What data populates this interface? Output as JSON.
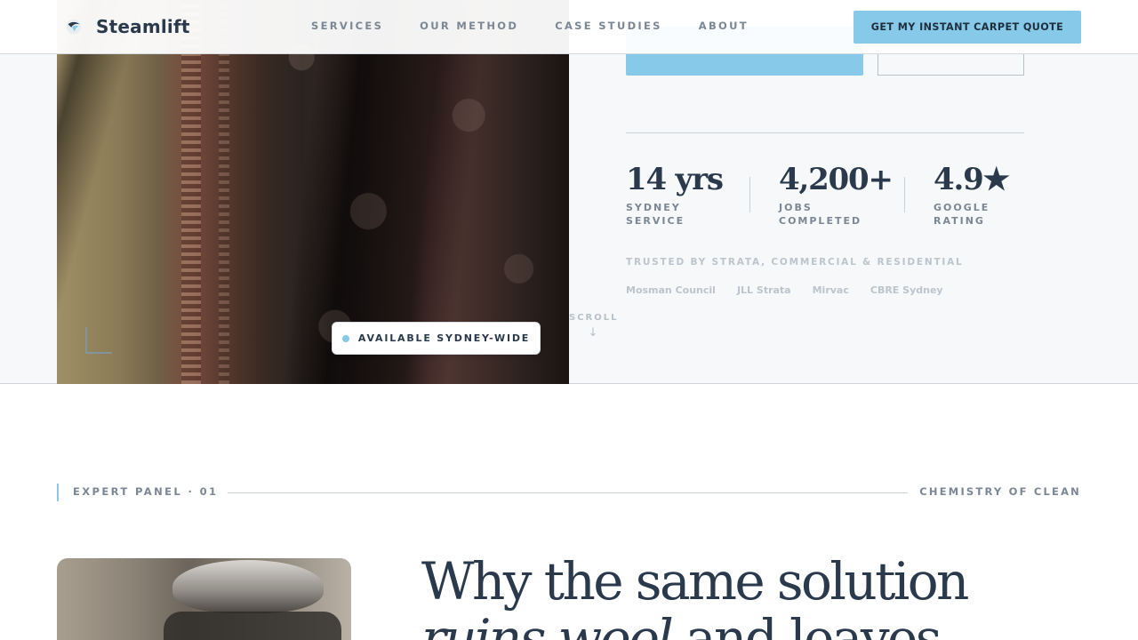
{
  "header": {
    "brand_name": "Steamlift",
    "nav": [
      "SERVICES",
      "OUR METHOD",
      "CASE STUDIES",
      "ABOUT"
    ],
    "cta_label": "GET MY INSTANT CARPET QUOTE"
  },
  "hero": {
    "badge_text": "AVAILABLE SYDNEY-WIDE",
    "scroll_label": "SCROLL",
    "stats": [
      {
        "value": "14 yrs",
        "label_line1": "SYDNEY",
        "label_line2": "SERVICE"
      },
      {
        "value": "4,200+",
        "label_line1": "JOBS",
        "label_line2": "COMPLETED"
      },
      {
        "value": "4.9★",
        "label_line1": "GOOGLE",
        "label_line2": "RATING"
      }
    ],
    "trusted_label": "TRUSTED BY STRATA, COMMERCIAL & RESIDENTIAL",
    "trusted_logos": [
      "Mosman Council",
      "JLL Strata",
      "Mirvac",
      "CBRE Sydney"
    ]
  },
  "section": {
    "panel_label": "EXPERT PANEL · 01",
    "panel_right": "CHEMISTRY OF CLEAN",
    "headline_line1": "Why the same solution",
    "headline_italic": "ruins wool",
    "headline_rest": " and leaves"
  },
  "colors": {
    "accent": "#86c9e8",
    "ink": "#2a3a4c",
    "muted": "#7b8794",
    "hero_bg": "#f6f8fa"
  }
}
